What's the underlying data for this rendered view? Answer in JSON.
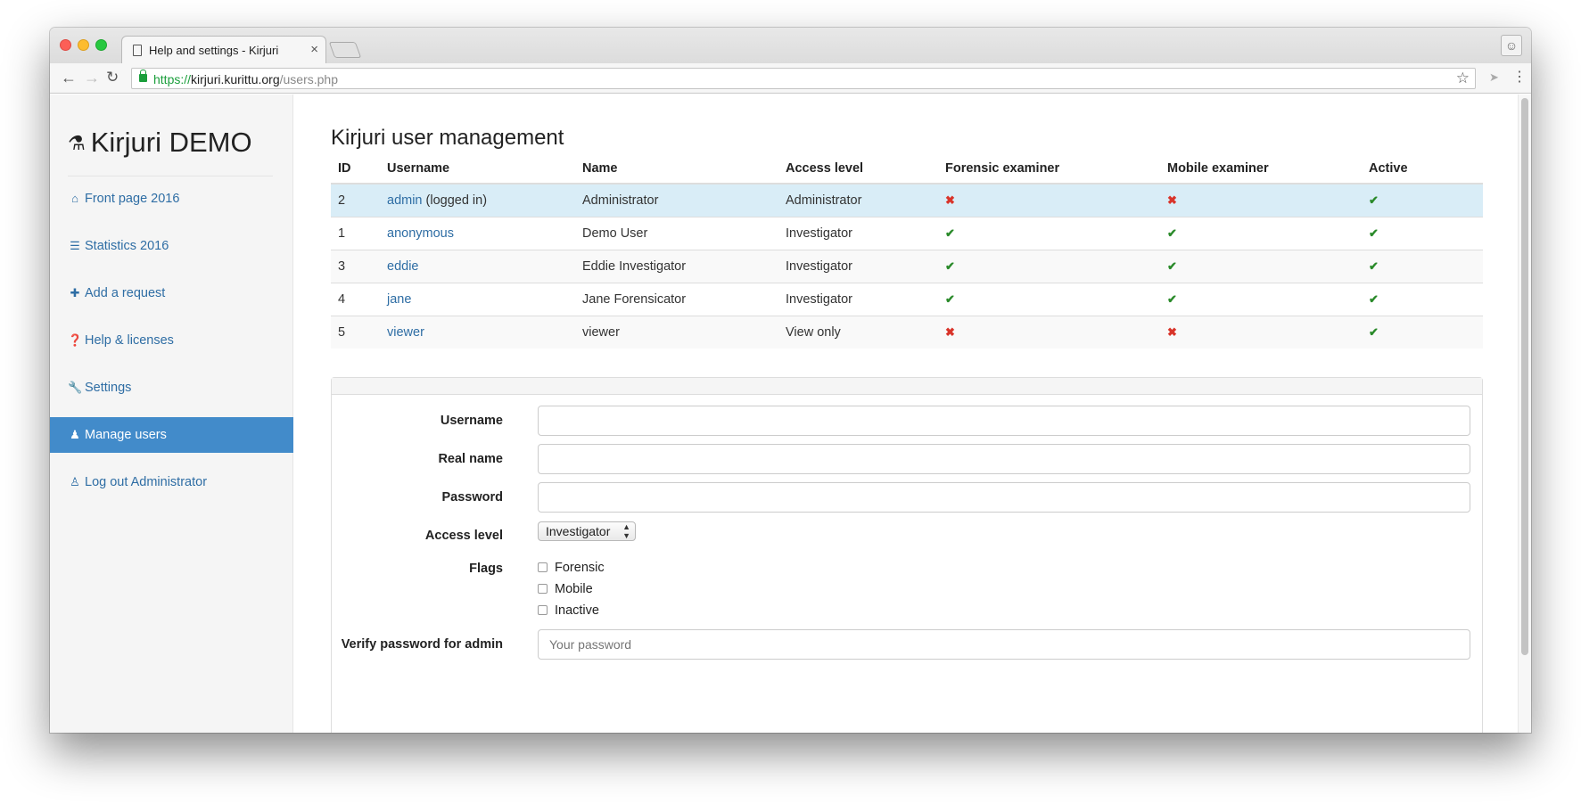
{
  "browser": {
    "tab_title": "Help and settings - Kirjuri",
    "tab_close": "×",
    "url_scheme": "https://",
    "url_host": "kirjuri.kurittu.org",
    "url_path": "/users.php",
    "icons": [
      "back-icon",
      "forward-icon",
      "reload-icon",
      "lock-icon",
      "star-icon",
      "extension-icon",
      "menu-icon",
      "profile-icon"
    ]
  },
  "sidebar": {
    "brand": "Kirjuri DEMO",
    "items": [
      {
        "label": "Front page 2016",
        "icon": "home-icon"
      },
      {
        "label": "Statistics 2016",
        "icon": "list-icon"
      },
      {
        "label": "Add a request",
        "icon": "plus-icon"
      },
      {
        "label": "Help & licenses",
        "icon": "question-icon"
      },
      {
        "label": "Settings",
        "icon": "wrench-icon"
      },
      {
        "label": "Manage users",
        "icon": "users-icon",
        "active": true
      },
      {
        "label": "Log out Administrator",
        "icon": "user-icon"
      }
    ]
  },
  "main": {
    "title": "Kirjuri user management",
    "table": {
      "headers": [
        "ID",
        "Username",
        "Name",
        "Access level",
        "Forensic examiner",
        "Mobile examiner",
        "Active"
      ],
      "rows": [
        {
          "id": "2",
          "username": "admin",
          "suffix": "(logged in)",
          "name": "Administrator",
          "access": "Administrator",
          "forensic": false,
          "mobile": false,
          "active": true
        },
        {
          "id": "1",
          "username": "anonymous",
          "suffix": "",
          "name": "Demo User",
          "access": "Investigator",
          "forensic": true,
          "mobile": true,
          "active": true
        },
        {
          "id": "3",
          "username": "eddie",
          "suffix": "",
          "name": "Eddie Investigator",
          "access": "Investigator",
          "forensic": true,
          "mobile": true,
          "active": true
        },
        {
          "id": "4",
          "username": "jane",
          "suffix": "",
          "name": "Jane Forensicator",
          "access": "Investigator",
          "forensic": true,
          "mobile": true,
          "active": true
        },
        {
          "id": "5",
          "username": "viewer",
          "suffix": "",
          "name": "viewer",
          "access": "View only",
          "forensic": false,
          "mobile": false,
          "active": true
        }
      ],
      "yes_glyph": "✔",
      "no_glyph": "✖"
    },
    "form": {
      "username_label": "Username",
      "username_value": "",
      "realname_label": "Real name",
      "realname_value": "",
      "password_label": "Password",
      "password_value": "",
      "access_label": "Access level",
      "access_selected": "Investigator",
      "flags_label": "Flags",
      "flags": [
        "Forensic",
        "Mobile",
        "Inactive"
      ],
      "verify_label": "Verify password for admin",
      "verify_placeholder": "Your password"
    }
  }
}
